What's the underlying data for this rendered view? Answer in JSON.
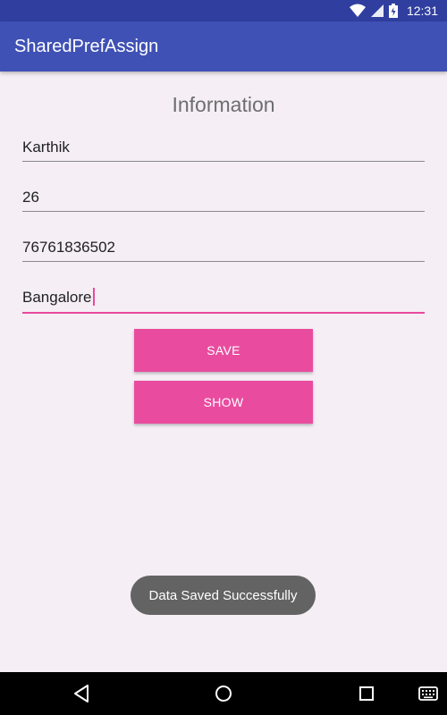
{
  "status_bar": {
    "time": "12:31"
  },
  "app_bar": {
    "title": "SharedPrefAssign"
  },
  "form": {
    "heading": "Information",
    "fields": [
      {
        "value": "Karthik"
      },
      {
        "value": "26"
      },
      {
        "value": "76761836502"
      },
      {
        "value": "Bangalore"
      }
    ],
    "save_label": "SAVE",
    "show_label": "SHOW"
  },
  "toast": {
    "message": "Data Saved Successfully"
  },
  "colors": {
    "status_bar": "#303f9f",
    "app_bar": "#3f51b5",
    "accent": "#e94c9f",
    "background": "#f5eef5"
  },
  "icons": [
    "wifi-icon",
    "signal-icon",
    "battery-icon",
    "back-icon",
    "home-icon",
    "recents-icon",
    "keyboard-icon"
  ]
}
